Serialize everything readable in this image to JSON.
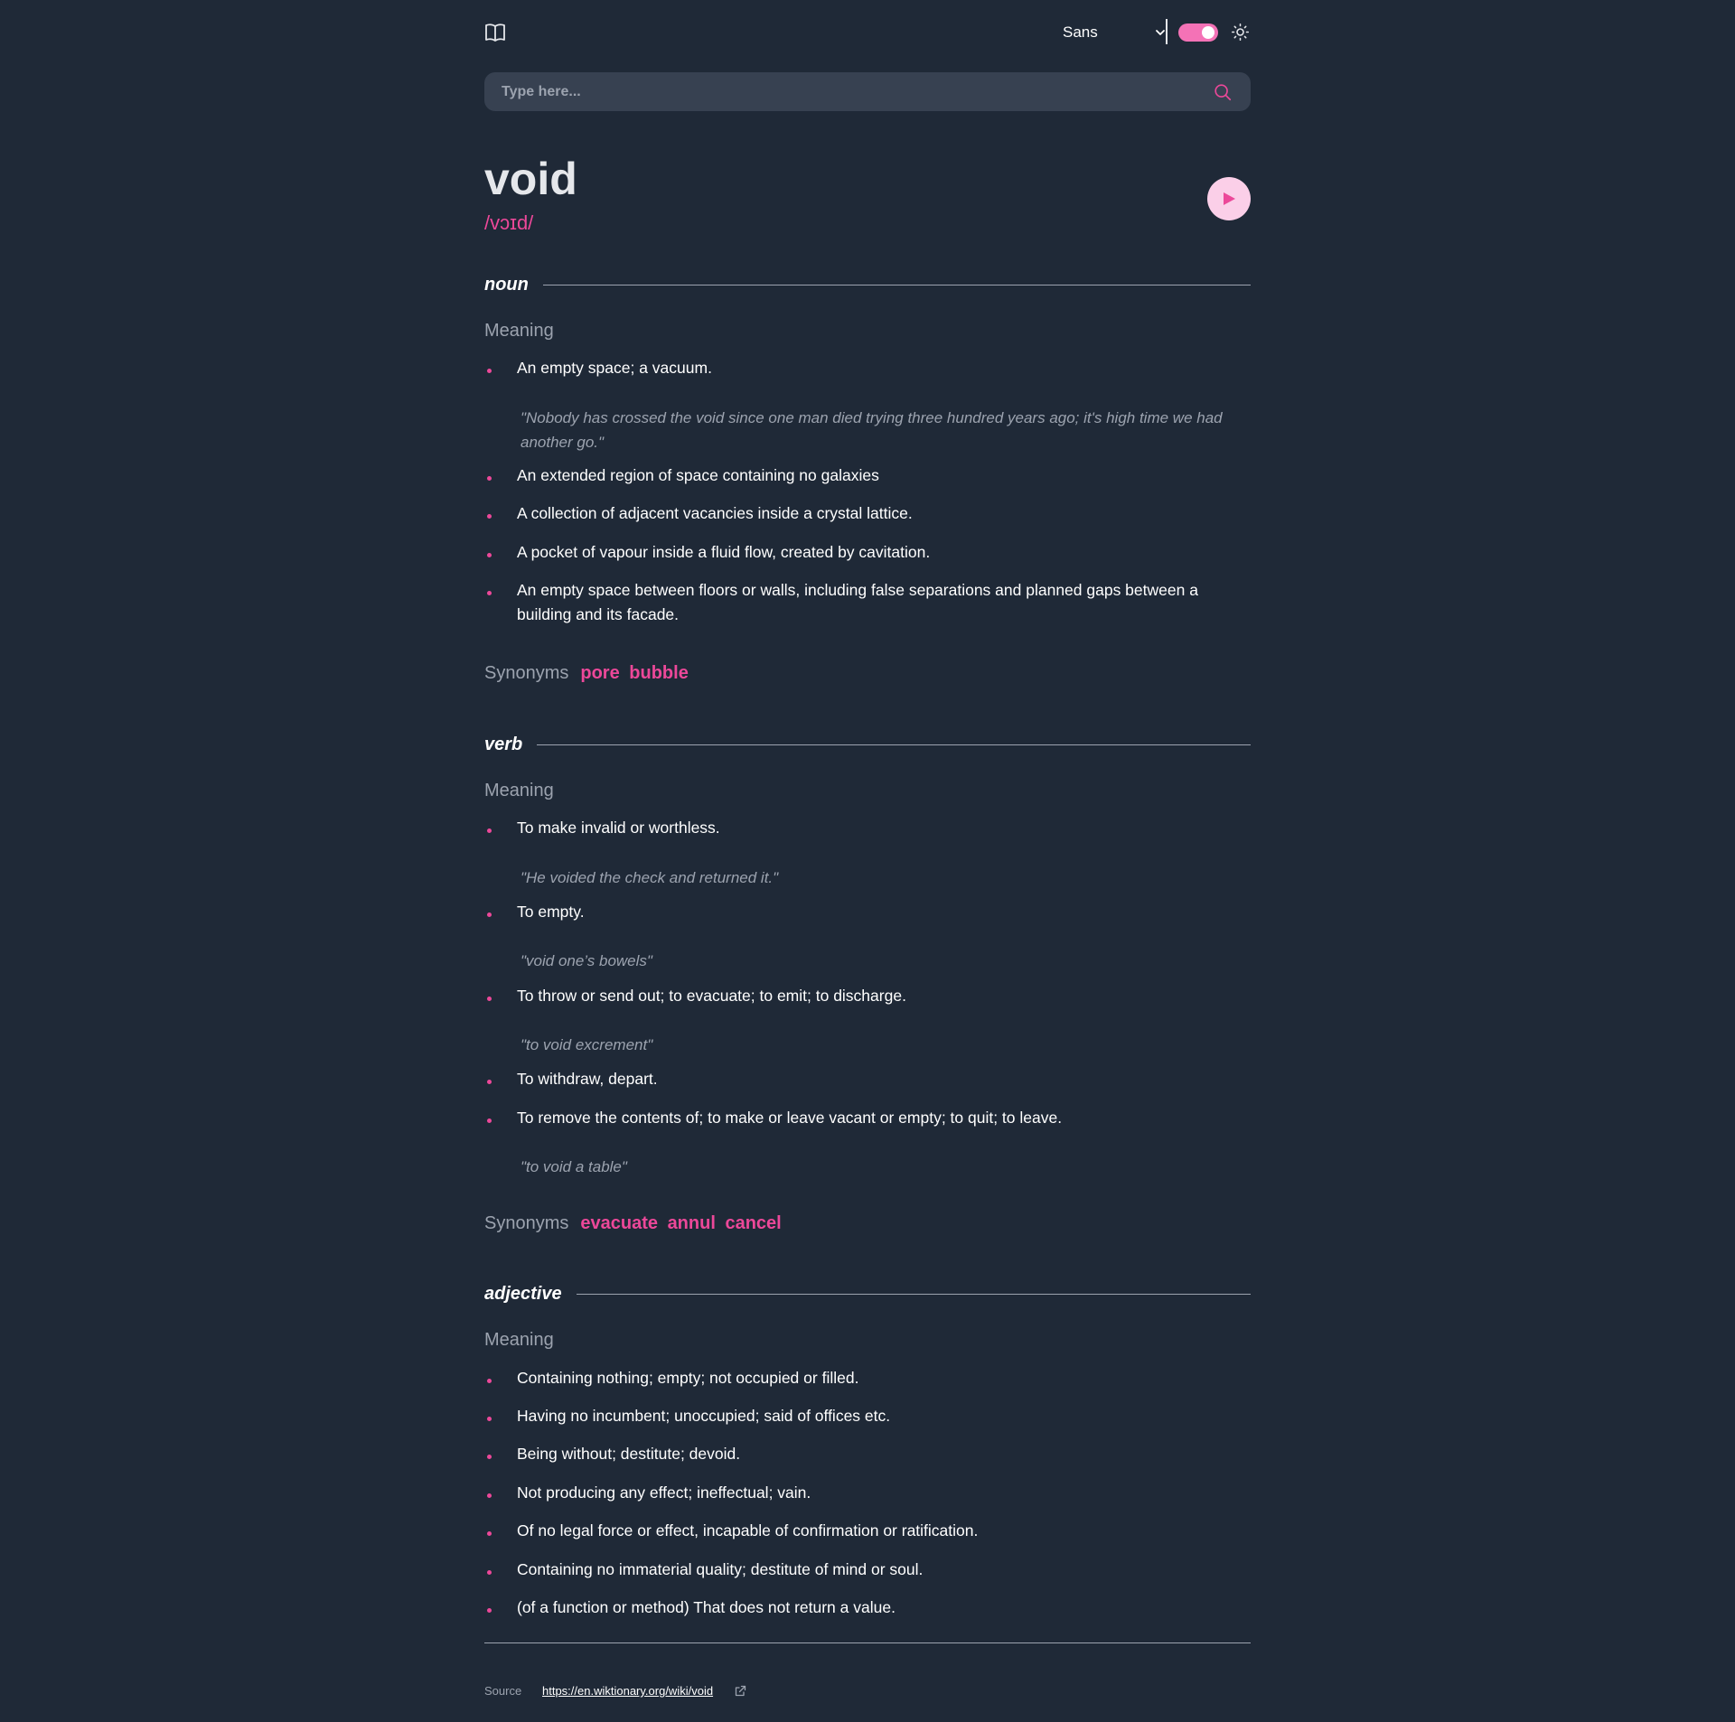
{
  "header": {
    "font_select": "Sans",
    "theme_toggle_on": true
  },
  "search": {
    "placeholder": "Type here...",
    "value": ""
  },
  "entry": {
    "word": "void",
    "phonetic": "/vɔɪd/"
  },
  "noun": {
    "label": "noun",
    "meaning_label": "Meaning",
    "definitions": [
      "An empty space; a vacuum.",
      "An extended region of space containing no galaxies",
      "A collection of adjacent vacancies inside a crystal lattice.",
      "A pocket of vapour inside a fluid flow, created by cavitation.",
      "An empty space between floors or walls, including false separations and planned gaps between a building and its facade."
    ],
    "examples": [
      "\"Nobody has crossed the void since one man died trying three hundred years ago; it's high time we had another go.\""
    ],
    "synonyms_label": "Synonyms",
    "synonyms": [
      "pore",
      "bubble"
    ]
  },
  "verb": {
    "label": "verb",
    "meaning_label": "Meaning",
    "definitions": [
      "To make invalid or worthless.",
      "To empty.",
      "To throw or send out; to evacuate; to emit; to discharge.",
      "To withdraw, depart.",
      "To remove the contents of; to make or leave vacant or empty; to quit; to leave."
    ],
    "examples": [
      "\"He voided the check and returned it.\"",
      "\"void one’s bowels\"",
      "\"to void excrement\"",
      "\"to void a table\""
    ],
    "synonyms_label": "Synonyms",
    "synonyms": [
      "evacuate",
      "annul",
      "cancel"
    ]
  },
  "adjective": {
    "label": "adjective",
    "meaning_label": "Meaning",
    "definitions": [
      "Containing nothing; empty; not occupied or filled.",
      "Having no incumbent; unoccupied; said of offices etc.",
      "Being without; destitute; devoid.",
      "Not producing any effect; ineffectual; vain.",
      "Of no legal force or effect, incapable of confirmation or ratification.",
      "Containing no immaterial quality; destitute of mind or soul.",
      "(of a function or method) That does not return a value."
    ]
  },
  "footer": {
    "source_label": "Source",
    "source_url": "https://en.wiktionary.org/wiki/void"
  },
  "colors": {
    "background": "#1f2937",
    "accent": "#ec4899",
    "muted": "#9ca3af",
    "search_bg": "#374151",
    "play_bg": "#fbcfe8"
  },
  "icons": [
    "book-icon",
    "chevron-down-icon",
    "sun-icon",
    "search-icon",
    "play-icon",
    "external-link-icon"
  ]
}
